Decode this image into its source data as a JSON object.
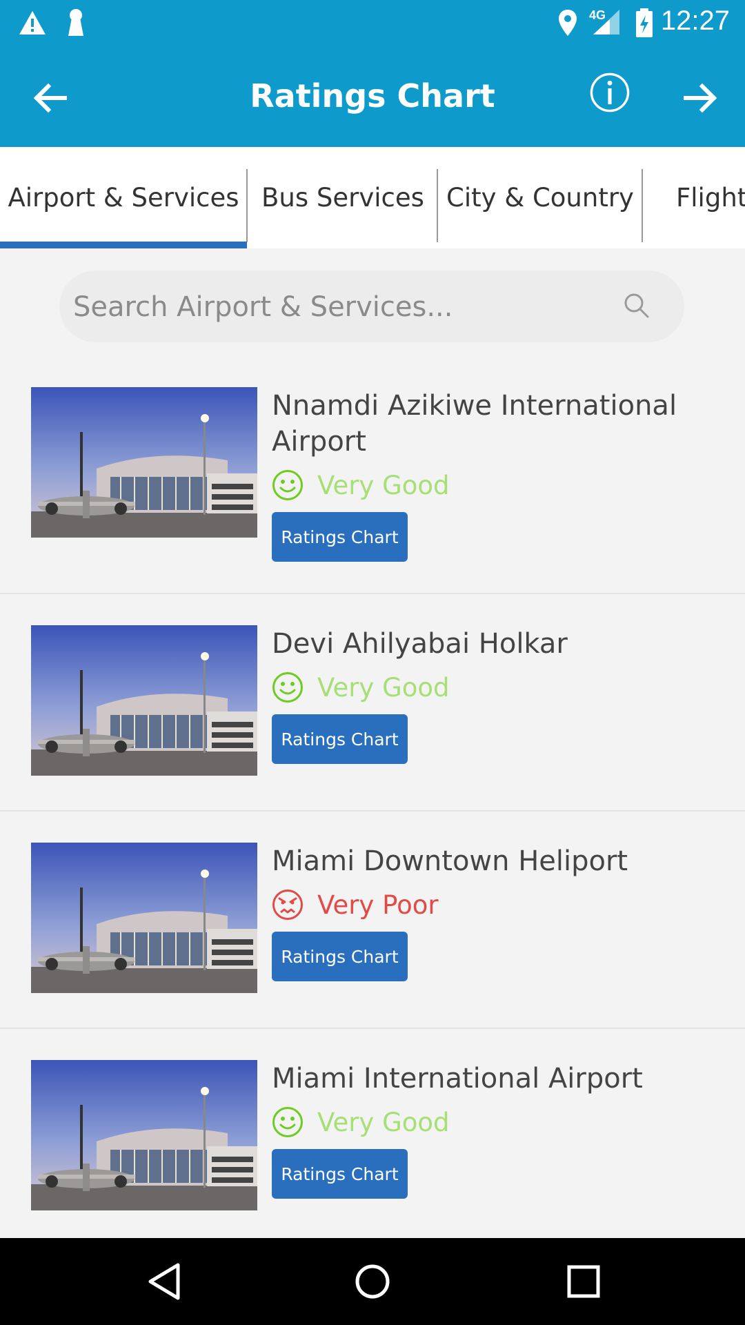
{
  "status_bar": {
    "time": "12:27",
    "network": "4G"
  },
  "app_bar": {
    "title": "Ratings Chart"
  },
  "tabs": [
    {
      "label": "Airport & Services",
      "selected": true
    },
    {
      "label": "Bus Services",
      "selected": false
    },
    {
      "label": "City & Country",
      "selected": false
    },
    {
      "label": "Flight",
      "selected": false
    }
  ],
  "search": {
    "placeholder": "Search Airport & Services...",
    "value": ""
  },
  "items": [
    {
      "name": "Nnamdi Azikiwe International Airport",
      "rating": "Very Good",
      "rating_color": "#a6df74",
      "face": "happy",
      "button": "Ratings Chart"
    },
    {
      "name": "Devi Ahilyabai Holkar",
      "rating": "Very Good",
      "rating_color": "#a6df74",
      "face": "happy",
      "button": "Ratings Chart"
    },
    {
      "name": "Miami Downtown Heliport",
      "rating": "Very Poor",
      "rating_color": "#e24b45",
      "face": "angry",
      "button": "Ratings Chart"
    },
    {
      "name": "Miami International Airport",
      "rating": "Very Good",
      "rating_color": "#a6df74",
      "face": "happy",
      "button": "Ratings Chart"
    }
  ],
  "colors": {
    "primary": "#0e9bcb",
    "accent": "#2a6fbd",
    "good": "#a6df74",
    "poor": "#e24b45"
  }
}
